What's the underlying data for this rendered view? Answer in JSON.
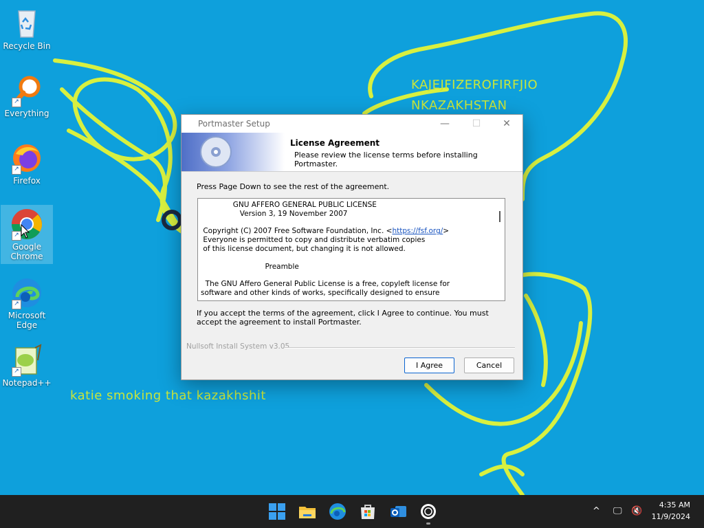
{
  "wallpaper": {
    "text1": "KAJEJFIZEROFIRFJIO",
    "text2": "NKAZAKHSTAN",
    "text3": "katie smoking that kazakhshit"
  },
  "desktop_icons": [
    {
      "label": "Recycle Bin",
      "icon": "recycle-bin-icon"
    },
    {
      "label": "Everything",
      "icon": "everything-search-icon"
    },
    {
      "label": "Firefox",
      "icon": "firefox-icon"
    },
    {
      "label": "Google Chrome",
      "icon": "chrome-icon"
    },
    {
      "label": "Microsoft Edge",
      "icon": "edge-icon"
    },
    {
      "label": "Notepad++",
      "icon": "notepad-plus-plus-icon"
    }
  ],
  "dialog": {
    "title": "Portmaster Setup",
    "header_title": "License Agreement",
    "header_subtitle": "Please review the license terms before installing Portmaster.",
    "instructions": "Press Page Down to see the rest of the agreement.",
    "license": {
      "line1": "              GNU AFFERO GENERAL PUBLIC LICENSE",
      "line2": "                 Version 3, 19 November 2007",
      "line3": " Copyright (C) 2007 Free Software Foundation, Inc. <",
      "link": "https://fsf.org/",
      "line3_end": ">",
      "line4": " Everyone is permitted to copy and distribute verbatim copies",
      "line5": " of this license document, but changing it is not allowed.",
      "line6": "                            Preamble",
      "line7": "  The GNU Affero General Public License is a free, copyleft license for",
      "line8": "software and other kinds of works, specifically designed to ensure"
    },
    "accept_text": "If you accept the terms of the agreement, click I Agree to continue. You must accept the agreement to install Portmaster.",
    "branding": "Nullsoft Install System v3.05",
    "agree_label": "I Agree",
    "cancel_label": "Cancel"
  },
  "taskbar": {
    "apps": [
      "windows-start-icon",
      "file-explorer-icon",
      "edge-icon",
      "microsoft-store-icon",
      "outlook-icon",
      "portmaster-icon"
    ],
    "time": "4:35 AM",
    "date": "11/9/2024"
  },
  "colors": {
    "desktop": "#0ea0dc",
    "scribble": "#d8f040",
    "taskbar": "#202020",
    "accent": "#0a64d0"
  }
}
